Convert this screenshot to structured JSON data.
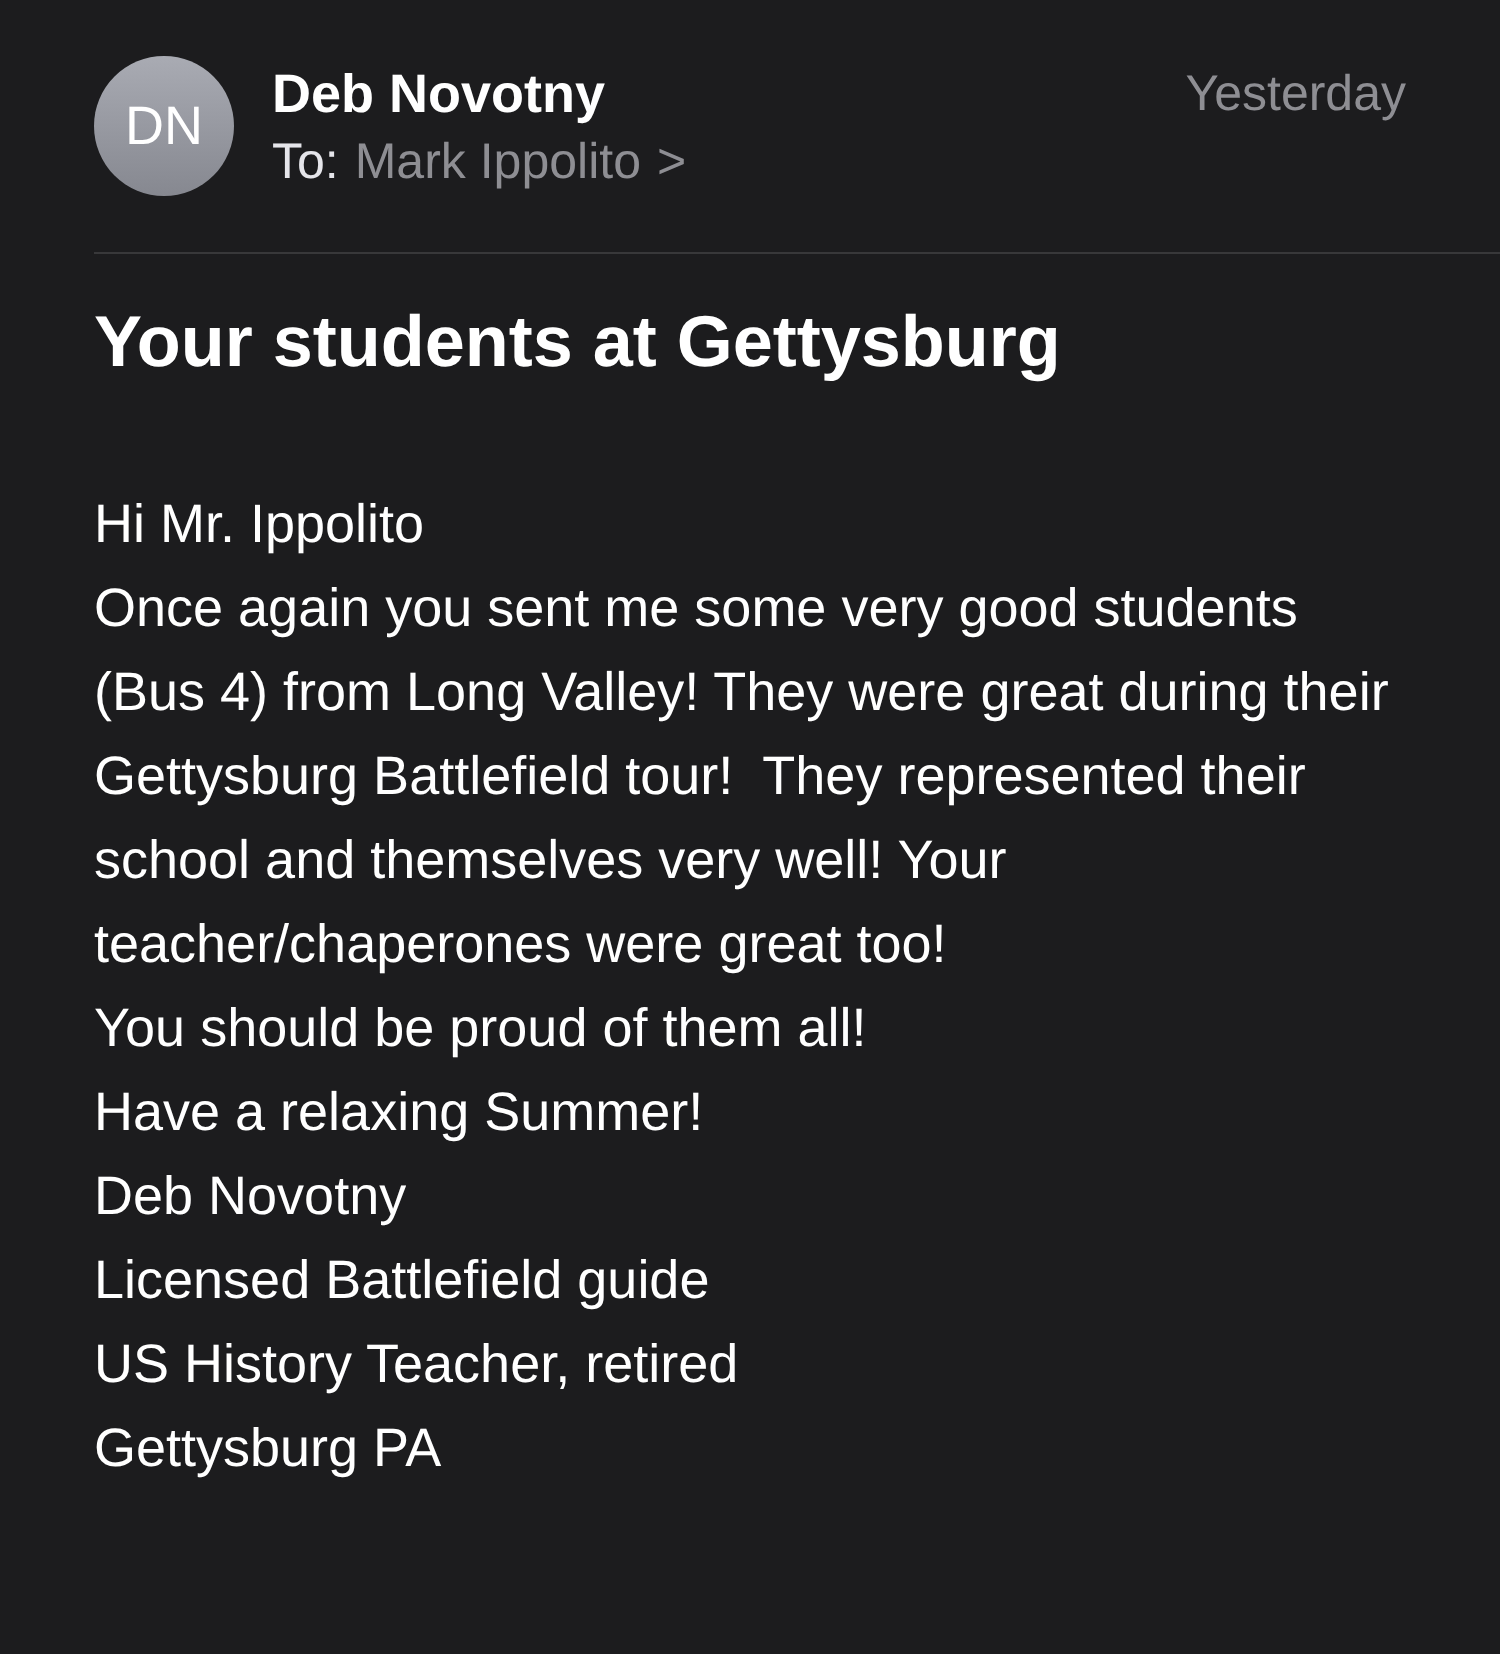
{
  "sender": {
    "initials": "DN",
    "name": "Deb Novotny",
    "to_label": "To:",
    "recipient": "Mark Ippolito",
    "chevron": ">"
  },
  "date": "Yesterday",
  "subject": "Your students at Gettysburg",
  "body": [
    "Hi Mr. Ippolito",
    "Once again you sent me some very good students (Bus 4) from Long Valley! They were great during their Gettysburg Battlefield tour!  They represented their school and themselves very well! Your teacher/chaperones were great too!",
    "You should be proud of them all!",
    "Have a relaxing Summer!",
    "Deb Novotny",
    "Licensed Battlefield guide",
    "US History Teacher, retired",
    "Gettysburg PA"
  ]
}
